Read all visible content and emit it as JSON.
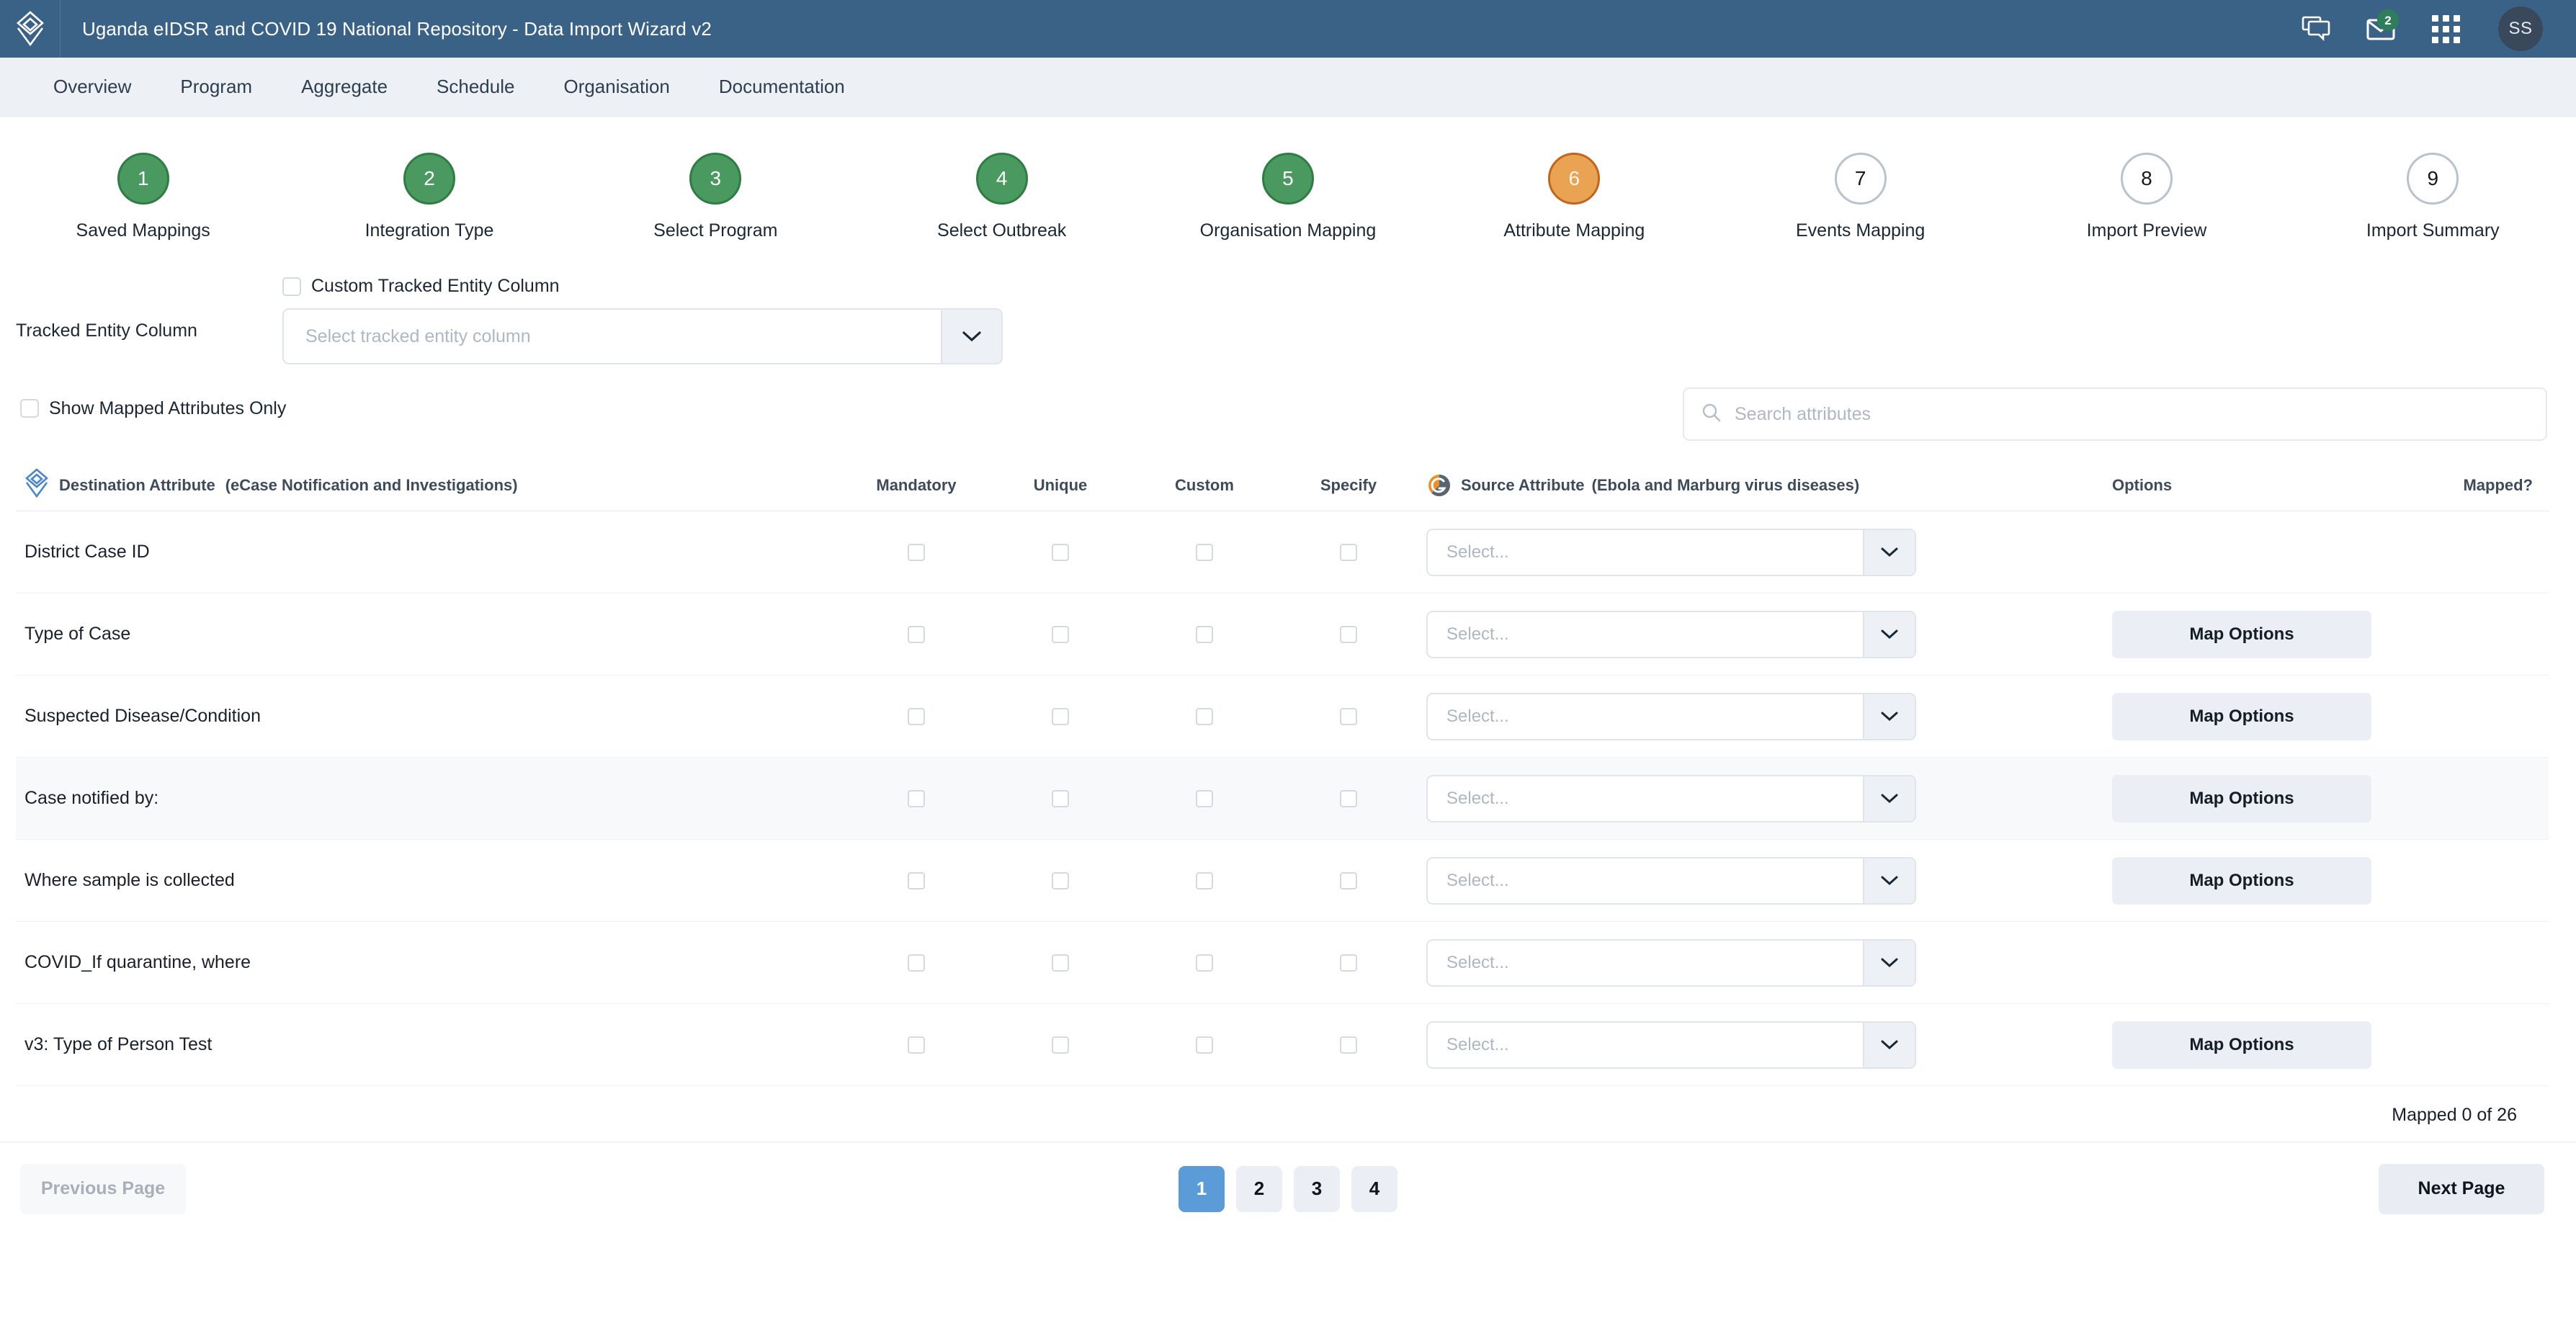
{
  "header": {
    "logo_icon": "dhis2-diamond-logo-icon",
    "title": "Uganda eIDSR and COVID 19 National Repository - Data Import Wizard v2",
    "messages_icon": "chat-bubbles-icon",
    "mail_icon": "envelope-icon",
    "mail_badge": "2",
    "apps_icon": "apps-grid-icon",
    "avatar_initials": "SS",
    "bar_color": "#3A6287"
  },
  "nav": {
    "items": [
      {
        "label": "Overview"
      },
      {
        "label": "Program"
      },
      {
        "label": "Aggregate"
      },
      {
        "label": "Schedule"
      },
      {
        "label": "Organisation"
      },
      {
        "label": "Documentation"
      }
    ]
  },
  "stepper": {
    "done_color": "#4A9960",
    "active_color": "#E9A352",
    "todo_color": "#FFFFFF",
    "steps": [
      {
        "number": "1",
        "label": "Saved Mappings",
        "state": "done"
      },
      {
        "number": "2",
        "label": "Integration Type",
        "state": "done"
      },
      {
        "number": "3",
        "label": "Select Program",
        "state": "done"
      },
      {
        "number": "4",
        "label": "Select Outbreak",
        "state": "done"
      },
      {
        "number": "5",
        "label": "Organisation Mapping",
        "state": "done"
      },
      {
        "number": "6",
        "label": "Attribute Mapping",
        "state": "active"
      },
      {
        "number": "7",
        "label": "Events Mapping",
        "state": "todo"
      },
      {
        "number": "8",
        "label": "Import Preview",
        "state": "todo"
      },
      {
        "number": "9",
        "label": "Import Summary",
        "state": "todo"
      }
    ]
  },
  "tracked_entity": {
    "label": "Tracked Entity Column",
    "custom_checkbox_label": "Custom Tracked Entity Column",
    "custom_checkbox_checked": false,
    "select_placeholder": "Select tracked entity column",
    "select_value": "",
    "chevron_icon": "chevron-down-icon"
  },
  "filters": {
    "show_mapped_only_label": "Show Mapped Attributes Only",
    "show_mapped_only_checked": false,
    "search_placeholder": "Search attributes",
    "search_value": "",
    "search_icon": "search-icon"
  },
  "table": {
    "dest_icon": "dhis2-diamond-logo-icon",
    "source_icon": "godata-circle-logo-icon",
    "columns": {
      "destination": "Destination Attribute",
      "destination_sub": "(eCase Notification and Investigations)",
      "mandatory": "Mandatory",
      "unique": "Unique",
      "custom": "Custom",
      "specify": "Specify",
      "source": "Source Attribute",
      "source_sub": "(Ebola and Marburg virus diseases)",
      "options": "Options",
      "mapped": "Mapped?"
    },
    "select_placeholder": "Select...",
    "map_options_label": "Map Options",
    "rows": [
      {
        "destination": "District Case ID",
        "mandatory": false,
        "unique": false,
        "custom": false,
        "specify": false,
        "source": "",
        "has_map_options": false,
        "highlighted": false
      },
      {
        "destination": "Type of Case",
        "mandatory": false,
        "unique": false,
        "custom": false,
        "specify": false,
        "source": "",
        "has_map_options": true,
        "highlighted": false
      },
      {
        "destination": "Suspected Disease/Condition",
        "mandatory": false,
        "unique": false,
        "custom": false,
        "specify": false,
        "source": "",
        "has_map_options": true,
        "highlighted": false
      },
      {
        "destination": "Case notified by:",
        "mandatory": false,
        "unique": false,
        "custom": false,
        "specify": false,
        "source": "",
        "has_map_options": true,
        "highlighted": true
      },
      {
        "destination": "Where sample is collected",
        "mandatory": false,
        "unique": false,
        "custom": false,
        "specify": false,
        "source": "",
        "has_map_options": true,
        "highlighted": false
      },
      {
        "destination": "COVID_If quarantine, where",
        "mandatory": false,
        "unique": false,
        "custom": false,
        "specify": false,
        "source": "",
        "has_map_options": false,
        "highlighted": false
      },
      {
        "destination": "v3: Type of Person Test",
        "mandatory": false,
        "unique": false,
        "custom": false,
        "specify": false,
        "source": "",
        "has_map_options": true,
        "highlighted": false
      }
    ],
    "mapped_count": "Mapped 0 of 26"
  },
  "footer": {
    "previous_label": "Previous Page",
    "previous_disabled": true,
    "next_label": "Next Page",
    "pages": [
      "1",
      "2",
      "3",
      "4"
    ],
    "current_page": "1",
    "current_page_color": "#5B9BD8"
  }
}
